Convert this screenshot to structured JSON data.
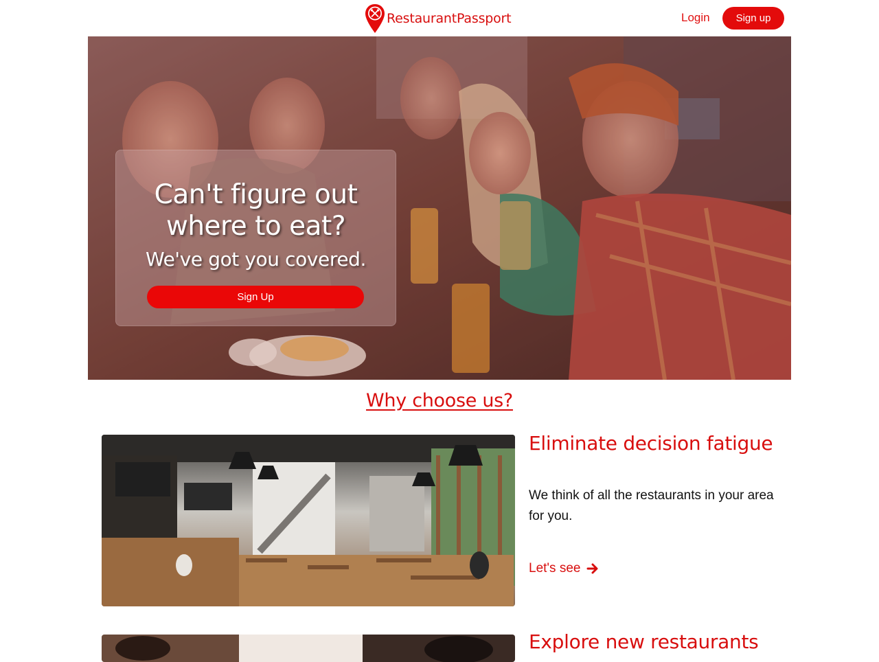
{
  "header": {
    "logo_text": "RestaurantPassport",
    "login_label": "Login",
    "signup_label": "Sign up"
  },
  "hero": {
    "headline_line1": "Can't figure out",
    "headline_line2": "where to eat?",
    "subheadline": "We've got you covered.",
    "cta_label": "Sign Up"
  },
  "why": {
    "title": "Why choose us?"
  },
  "features": [
    {
      "title": "Eliminate decision fatigue",
      "text": "We think of all the restaurants in your area for you.",
      "link_label": "Let's see"
    },
    {
      "title": "Explore new restaurants"
    }
  ],
  "colors": {
    "brand_red": "#e30b0b",
    "text_red": "#d80e0e"
  },
  "icons": {
    "logo": "map-pin-fork-knife-icon",
    "link_arrow": "arrow-right-icon"
  }
}
